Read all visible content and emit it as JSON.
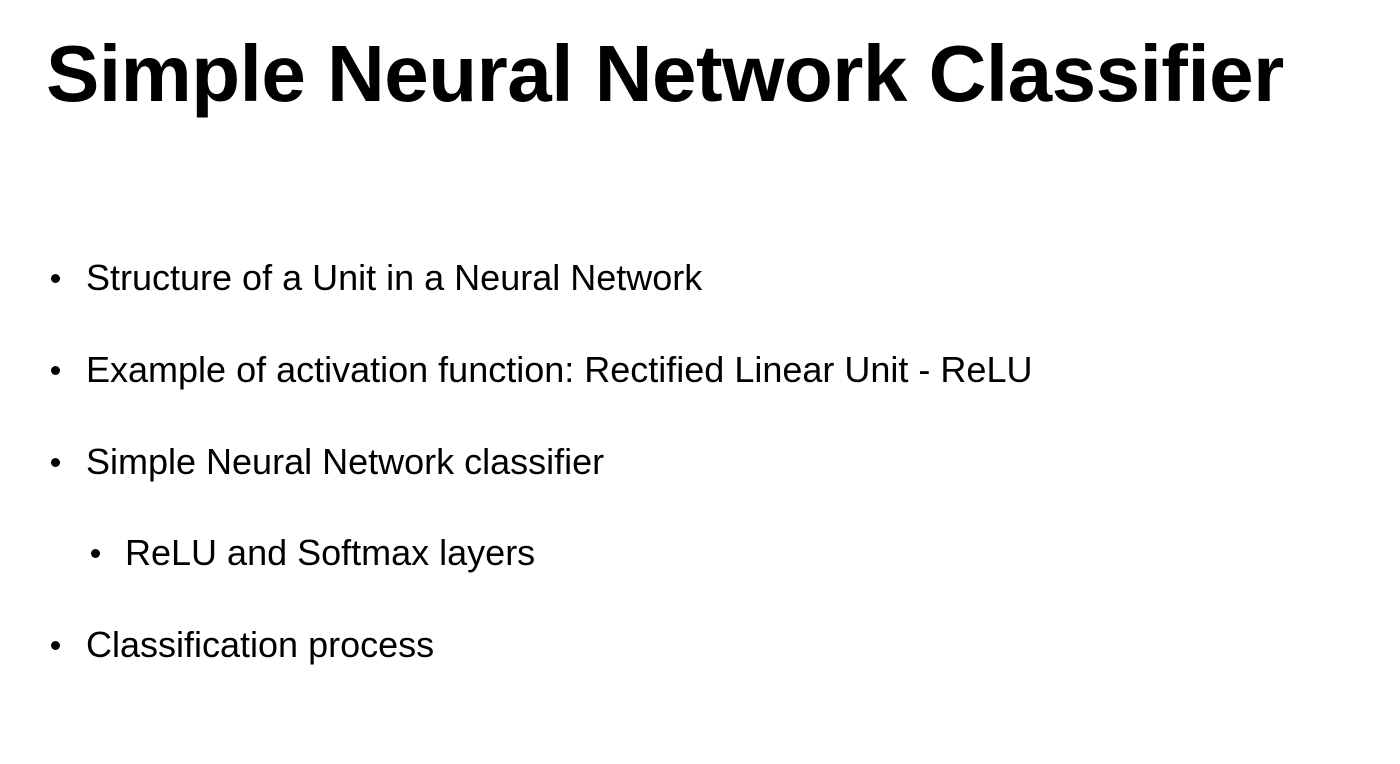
{
  "slide": {
    "title": "Simple Neural Network Classifier",
    "bullets": [
      {
        "text": "Structure of a Unit in a Neural Network",
        "level": 1
      },
      {
        "text": "Example of activation function: Rectified Linear Unit - ReLU",
        "level": 1
      },
      {
        "text": "Simple Neural Network classifier",
        "level": 1
      },
      {
        "text": "ReLU and Softmax layers",
        "level": 2
      },
      {
        "text": "Classification process",
        "level": 1
      }
    ]
  }
}
